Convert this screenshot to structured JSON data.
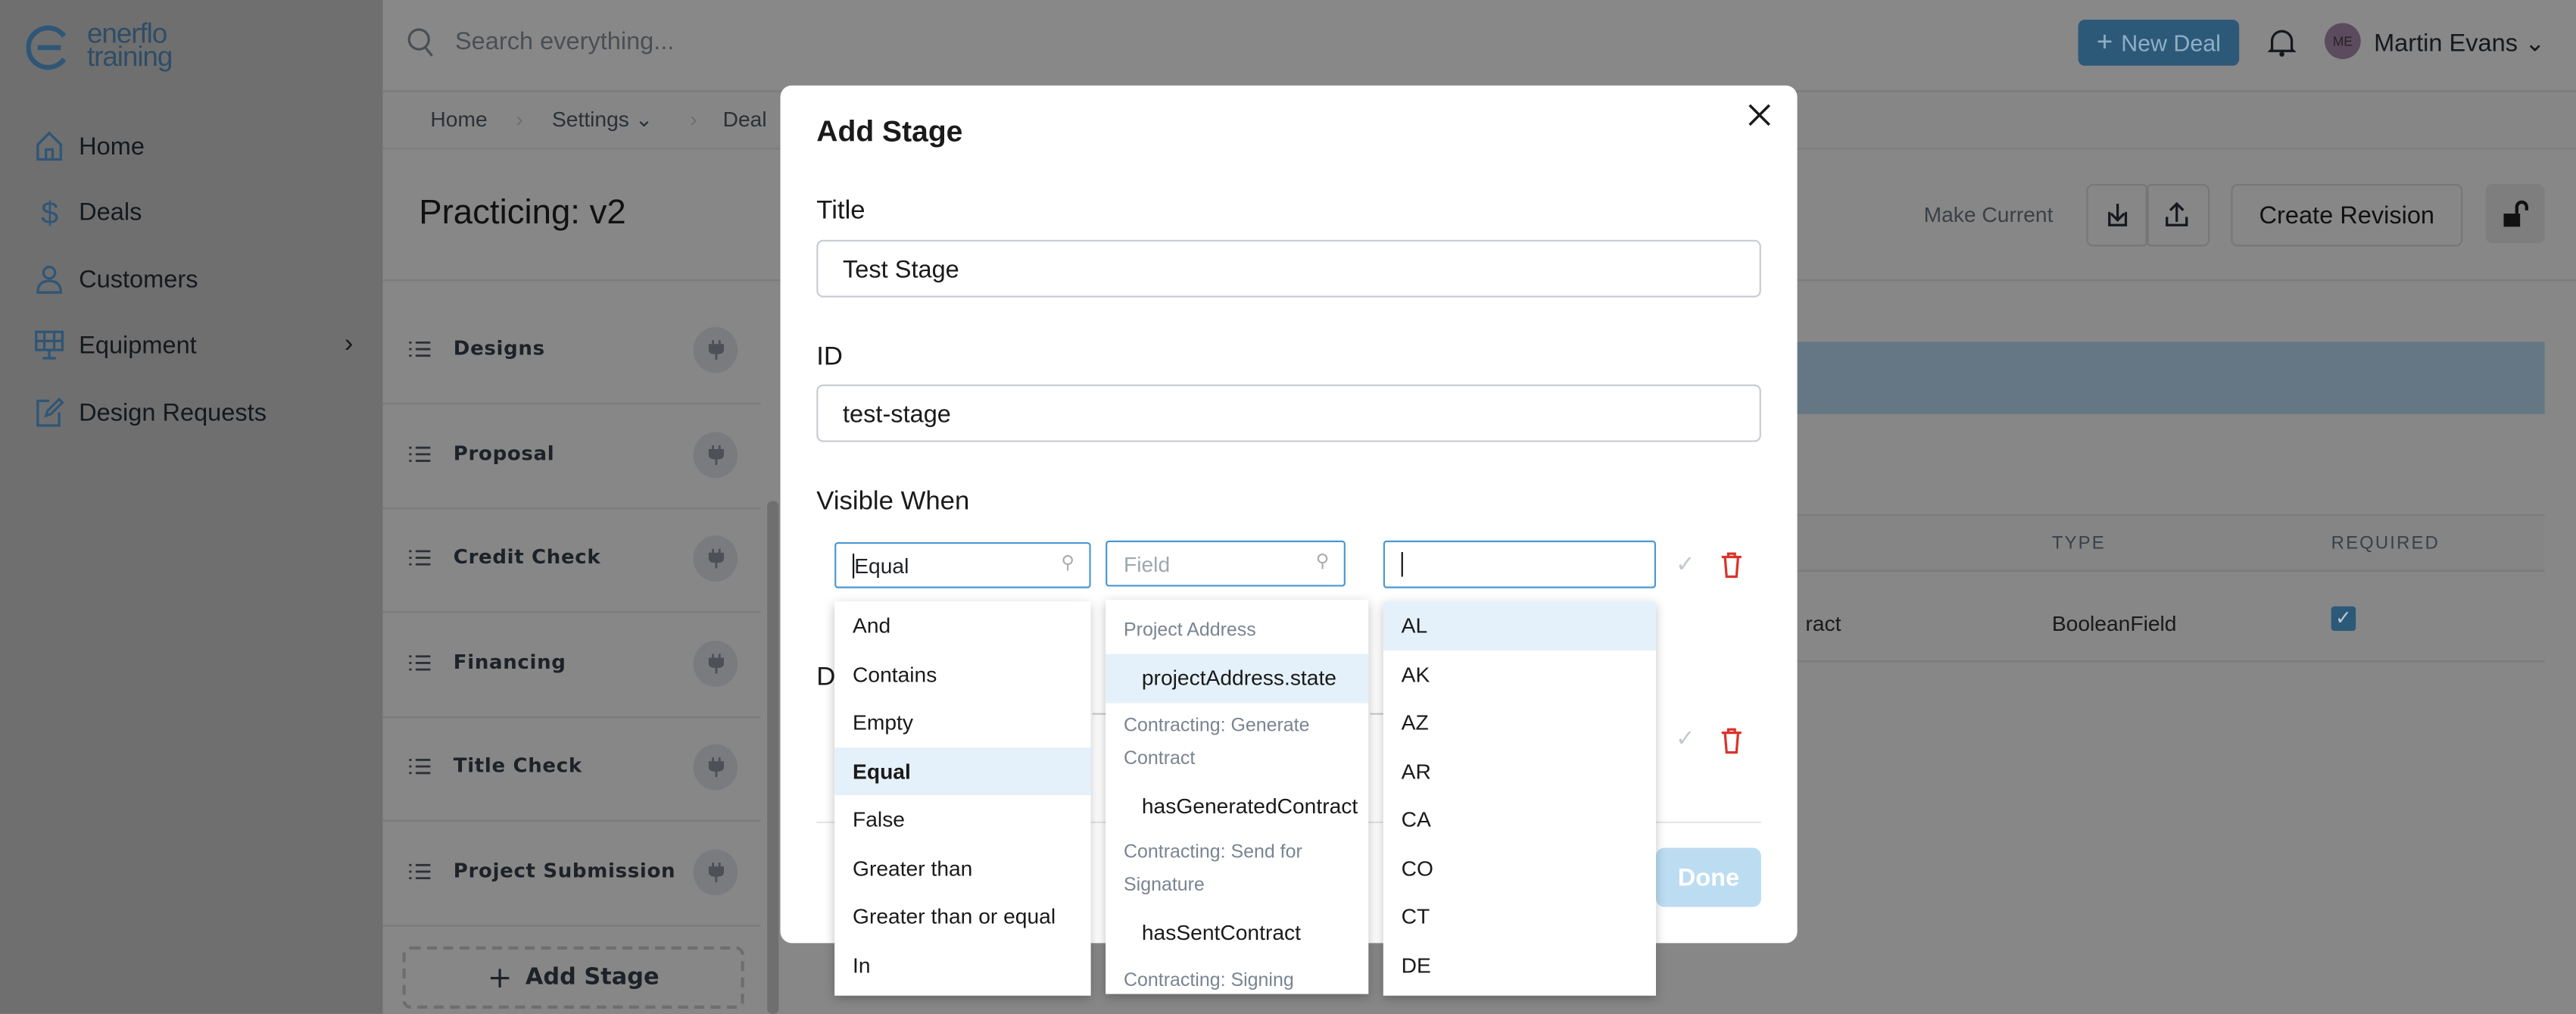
{
  "app": {
    "logo_line1": "enerflo",
    "logo_line2": "training"
  },
  "sidebar": {
    "items": [
      {
        "label": "Home",
        "icon": "home-icon"
      },
      {
        "label": "Deals",
        "icon": "dollar-icon"
      },
      {
        "label": "Customers",
        "icon": "user-icon"
      },
      {
        "label": "Equipment",
        "icon": "solar-panel-icon"
      },
      {
        "label": "Design Requests",
        "icon": "edit-icon"
      }
    ]
  },
  "topbar": {
    "search_placeholder": "Search everything...",
    "new_deal": "New Deal",
    "user_initials": "ME",
    "user_name": "Martin Evans"
  },
  "breadcrumb": [
    "Home",
    "Settings",
    "Deal"
  ],
  "page": {
    "title": "Practicing: v2",
    "make_current": "Make Current",
    "create_revision": "Create Revision"
  },
  "stages": [
    "Designs",
    "Proposal",
    "Credit Check",
    "Financing",
    "Title Check",
    "Project Submission"
  ],
  "add_stage": "Add Stage",
  "table": {
    "headers": [
      "TYPE",
      "REQUIRED"
    ],
    "row": {
      "name_fragment": "ract",
      "type": "BooleanField",
      "required": true
    }
  },
  "modal": {
    "title": "Add Stage",
    "title_label": "Title",
    "title_value": "Test Stage",
    "id_label": "ID",
    "id_value": "test-stage",
    "visible_when_label": "Visible When",
    "hidden_label_fragment": "D",
    "operator_value": "Equal",
    "field_placeholder": "Field",
    "value_input": "",
    "done": "Done",
    "operators": [
      "And",
      "Contains",
      "Empty",
      "Equal",
      "False",
      "Greater than",
      "Greater than or equal",
      "In"
    ],
    "operator_selected": "Equal",
    "field_groups": [
      {
        "group": "Project Address",
        "fields": [
          "projectAddress.state"
        ]
      },
      {
        "group": "Contracting: Generate Contract",
        "fields": [
          "hasGeneratedContract"
        ]
      },
      {
        "group": "Contracting: Send for Signature",
        "fields": [
          "hasSentContract"
        ]
      },
      {
        "group": "Contracting: Signing",
        "fields": []
      }
    ],
    "field_selected": "projectAddress.state",
    "states": [
      "AL",
      "AK",
      "AZ",
      "AR",
      "CA",
      "CO",
      "CT",
      "DE"
    ],
    "state_highlighted": "AL"
  },
  "colors": {
    "accent": "#4a97d1",
    "danger": "#d9342b",
    "done_disabled": "#bcdcf1",
    "highlight": "#e5f1fa"
  }
}
